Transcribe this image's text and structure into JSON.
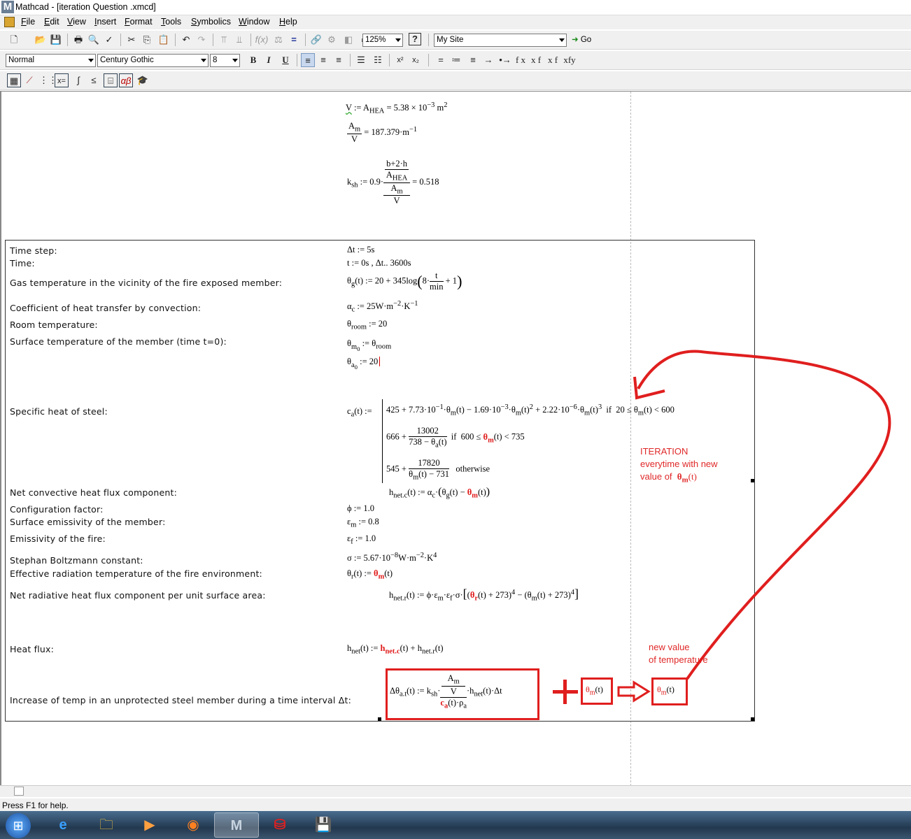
{
  "window": {
    "title": "Mathcad - [iteration Question .xmcd]"
  },
  "menu": [
    "File",
    "Edit",
    "View",
    "Insert",
    "Format",
    "Tools",
    "Symbolics",
    "Window",
    "Help"
  ],
  "toolbar": {
    "zoom": "125%",
    "site": "My Site",
    "go": "Go"
  },
  "format": {
    "style": "Normal",
    "font": "Century Gothic",
    "size": "8",
    "bold": "B",
    "italic": "I",
    "underline": "U"
  },
  "labels": {
    "time_step": "Time step:",
    "time": "Time:",
    "gas_temp": "Gas temperature in the vicinity of the fire exposed member:",
    "coef_conv": "Coefficient of heat transfer by convection:",
    "room_temp": "Room temperature:",
    "surface_temp": "Surface temperature of the member (time t=0):",
    "specific_heat": "Specific heat of steel:",
    "net_conv": "Net convective heat flux component:",
    "config": "Configuration factor:",
    "surf_emis": "Surface emissivity of the member:",
    "emis_fire": "Emissivity of the fire:",
    "stephan": "Stephan Boltzmann constant:",
    "eff_rad": "Effective radiation temperature of the fire environment:",
    "net_rad": "Net radiative heat flux component per unit surface area:",
    "heat_flux": "Heat flux:",
    "increase": "Increase of temp in an unprotected steel member during a time interval Δt:"
  },
  "math": {
    "v_eq": "V := AHEA = 5.38 × 10⁻³ m²",
    "am_v": "= 187.379·m⁻¹",
    "ksh": "= 0.518",
    "dt": "Δt := 5s",
    "t": "t := 0s , Δt.. 3600s",
    "room": "θroom := 20",
    "a0": "θa0 := 20",
    "phi": "ϕ := 1.0",
    "em": "εm := 0.8",
    "ef": "εf := 1.0",
    "heat_a": "666 +",
    "heat_b": "545 +",
    "otherwise": "otherwise"
  },
  "annotations": {
    "iteration": "ITERATION",
    "everytime": "everytime with new",
    "value_of": "value of",
    "new_value": "new value",
    "of_temp": "of temperature"
  },
  "status": "Press F1 for help.",
  "colors": {
    "annotation": "#e01e1e",
    "window": "#f0f0f0"
  }
}
